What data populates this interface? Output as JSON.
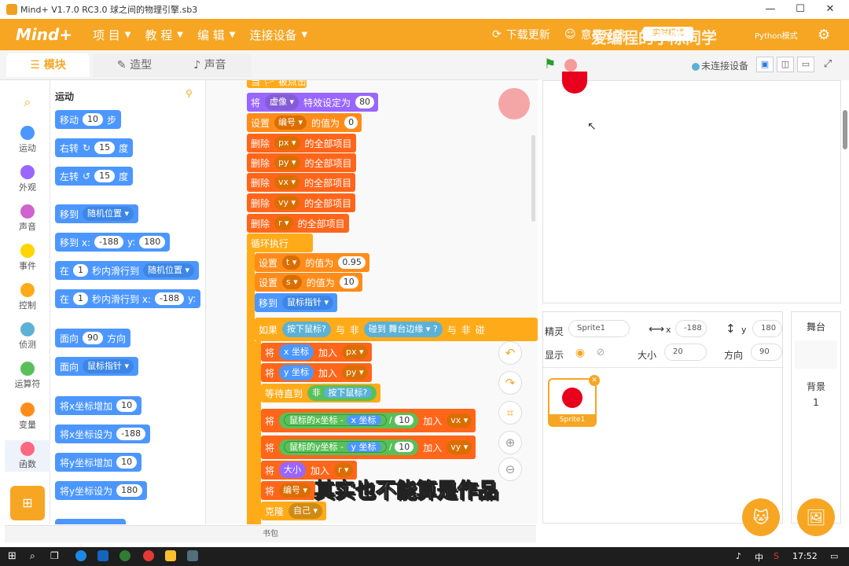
{
  "window": {
    "title": "Mind+ V1.7.0 RC3.0   球之间的物理引擎.sb3",
    "min": "—",
    "max": "☐",
    "close": "✕"
  },
  "menubar": {
    "logo": "Mind+",
    "items": [
      {
        "label": "项 目"
      },
      {
        "label": "教 程"
      },
      {
        "label": "编 辑"
      },
      {
        "label": "连接设备"
      }
    ],
    "update": "下载更新",
    "feedback": "意见反馈",
    "mode_button": "实时模式",
    "python_label": "Python模式",
    "watermark": "爱编程的小陈同学"
  },
  "tabs": {
    "blocks": "模块",
    "costumes": "造型",
    "sounds": "声音"
  },
  "categories": [
    {
      "label": "运动",
      "color": "#4c97ff"
    },
    {
      "label": "外观",
      "color": "#9966ff"
    },
    {
      "label": "声音",
      "color": "#cf63cf"
    },
    {
      "label": "事件",
      "color": "#ffd500"
    },
    {
      "label": "控制",
      "color": "#ffab19"
    },
    {
      "label": "侦测",
      "color": "#5cb1d6"
    },
    {
      "label": "运算符",
      "color": "#59c059"
    },
    {
      "label": "变量",
      "color": "#ff8c1a"
    },
    {
      "label": "函数",
      "color": "#ff6680"
    }
  ],
  "palette": {
    "heading": "运动",
    "move": {
      "a": "移动",
      "v": "10",
      "b": "步"
    },
    "turn_right": {
      "a": "右转",
      "v": "15",
      "b": "度"
    },
    "turn_left": {
      "a": "左转",
      "v": "15",
      "b": "度"
    },
    "goto_random": {
      "a": "移到",
      "d": "随机位置"
    },
    "goto_xy": {
      "a": "移到 x:",
      "x": "-188",
      "b": "y:",
      "y": "180"
    },
    "glide_random": {
      "a": "在",
      "v": "1",
      "b": "秒内滑行到",
      "d": "随机位置"
    },
    "glide_xy": {
      "a": "在",
      "v": "1",
      "b": "秒内滑行到 x:",
      "x": "-188",
      "c": "y:"
    },
    "point_dir": {
      "a": "面向",
      "v": "90",
      "b": "方向"
    },
    "point_towards": {
      "a": "面向",
      "d": "鼠标指针"
    },
    "change_x": {
      "a": "将x坐标增加",
      "v": "10"
    },
    "set_x": {
      "a": "将x坐标设为",
      "v": "-188"
    },
    "change_y": {
      "a": "将y坐标增加",
      "v": "10"
    },
    "set_y": {
      "a": "将y坐标设为",
      "v": "180"
    }
  },
  "script": {
    "hat": "当 🏳 被点击",
    "effect": {
      "a": "将",
      "d": "虚像",
      "b": "特效设定为",
      "v": "80"
    },
    "set_id": {
      "a": "设置",
      "d": "编号",
      "b": "的值为",
      "v": "0"
    },
    "del_px": {
      "a": "删除",
      "d": "px",
      "b": "的全部项目"
    },
    "del_py": {
      "a": "删除",
      "d": "py",
      "b": "的全部项目"
    },
    "del_vx": {
      "a": "删除",
      "d": "vx",
      "b": "的全部项目"
    },
    "del_vy": {
      "a": "删除",
      "d": "vy",
      "b": "的全部项目"
    },
    "del_r": {
      "a": "删除",
      "d": "r",
      "b": "的全部项目"
    },
    "forever": "循环执行",
    "set_t": {
      "a": "设置",
      "d": "t",
      "b": "的值为",
      "v": "0.95"
    },
    "set_s": {
      "a": "设置",
      "d": "s",
      "b": "的值为",
      "v": "10"
    },
    "goto_mouse": {
      "a": "移到",
      "d": "鼠标指针"
    },
    "if": {
      "a": "如果",
      "c1": "按下鼠标?",
      "and": "与",
      "not": "非",
      "touch": "碰到",
      "edge": "舞台边缘",
      "q": "?",
      "and2": "与",
      "not2": "非",
      "tail": "碰"
    },
    "add_px": {
      "a": "将",
      "r": "x 坐标",
      "b": "加入",
      "d": "px"
    },
    "add_py": {
      "a": "将",
      "r": "y 坐标",
      "b": "加入",
      "d": "py"
    },
    "wait_until": {
      "a": "等待直到",
      "not": "非",
      "c": "按下鼠标?"
    },
    "add_vx": {
      "a": "将",
      "m": "鼠标的x坐标",
      "minus": "-",
      "r": "x 坐标",
      "div": "/",
      "v": "10",
      "b": "加入",
      "d": "vx"
    },
    "add_vy": {
      "a": "将",
      "m": "鼠标的y坐标",
      "minus": "-",
      "r": "y 坐标",
      "div": "/",
      "v": "10",
      "b": "加入",
      "d": "vy"
    },
    "add_r": {
      "a": "将",
      "r": "大小",
      "b": "加入",
      "d": "r"
    },
    "add_id": {
      "a": "将",
      "d": "编号"
    },
    "clone": {
      "a": "克隆",
      "d": "自己"
    }
  },
  "stage_bar": {
    "status": "未连接设备"
  },
  "sprite_info": {
    "sprite_label": "精灵",
    "sprite_name": "Sprite1",
    "x_label": "x",
    "x": "-188",
    "y_label": "y",
    "y": "180",
    "show_label": "显示",
    "size_label": "大小",
    "size": "20",
    "dir_label": "方向",
    "dir": "90",
    "thumb_label": "Sprite1"
  },
  "stage_panel": {
    "title": "舞台",
    "bg_label": "背景",
    "bg_count": "1"
  },
  "bottom": {
    "backpack": "书包"
  },
  "subtitle": "其实也不能算是作品",
  "taskbar": {
    "time": "17:52",
    "ime": "中",
    "ime2": "S"
  },
  "colors": {
    "accent": "#f6a623",
    "sprite_red": "#e8001c"
  }
}
